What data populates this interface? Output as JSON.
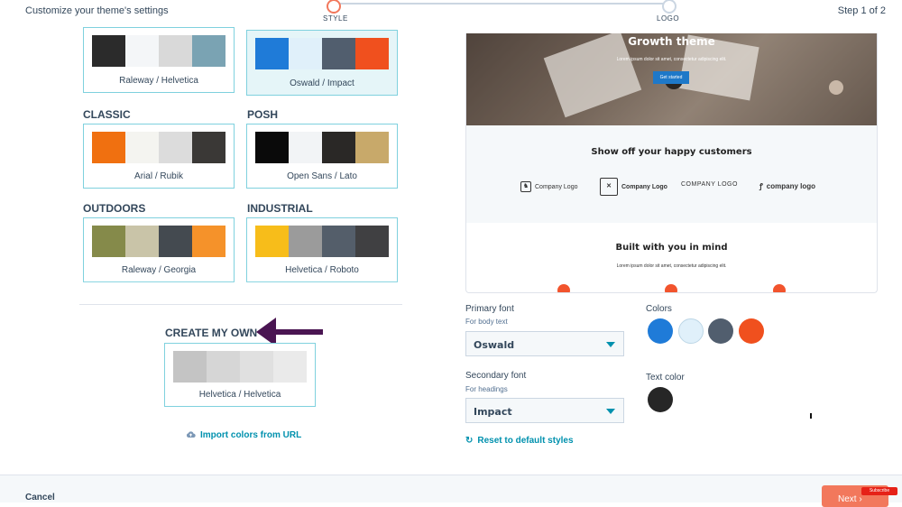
{
  "header": {
    "title": "Customize your theme's settings",
    "step_counter": "Step 1 of 2",
    "steps": [
      {
        "label": "STYLE"
      },
      {
        "label": "LOGO"
      }
    ]
  },
  "themes": [
    {
      "name": "",
      "font_pair": "Raleway / Helvetica",
      "colors": [
        "#2b2b2b",
        "#f4f6f8",
        "#d9d9d9",
        "#7aa3b3"
      ],
      "selected": false
    },
    {
      "name": "",
      "font_pair": "Oswald / Impact",
      "colors": [
        "#1f7bd8",
        "#e0f0fa",
        "#515e6e",
        "#f0501e"
      ],
      "selected": true
    },
    {
      "name": "CLASSIC",
      "font_pair": "Arial / Rubik",
      "colors": [
        "#f07010",
        "#f4f4f0",
        "#dcdcdc",
        "#3a3836"
      ],
      "selected": false
    },
    {
      "name": "POSH",
      "font_pair": "Open Sans / Lato",
      "colors": [
        "#0a0a0a",
        "#f2f4f6",
        "#2a2826",
        "#c8a96a"
      ],
      "selected": false
    },
    {
      "name": "OUTDOORS",
      "font_pair": "Raleway / Georgia",
      "colors": [
        "#858a4a",
        "#c9c4a8",
        "#444a50",
        "#f5922a"
      ],
      "selected": false
    },
    {
      "name": "INDUSTRIAL",
      "font_pair": "Helvetica / Roboto",
      "colors": [
        "#f7bd1a",
        "#9b9b9b",
        "#545e6a",
        "#404042"
      ],
      "selected": false
    }
  ],
  "create_own": {
    "title": "CREATE MY OWN",
    "font_pair": "Helvetica / Helvetica",
    "colors": [
      "#c4c4c4",
      "#d6d6d6",
      "#e0e0e0",
      "#eaeaea"
    ],
    "import_link": "Import colors from URL"
  },
  "preview": {
    "hero_title": "Growth theme",
    "hero_sub": "Lorem ipsum dolor sit amet, consectetur adipiscing elit.",
    "hero_button": "Get started",
    "customers_title": "Show off your happy customers",
    "logos": [
      "Company Logo",
      "Company Logo",
      "COMPANY LOGO",
      "company logo"
    ],
    "built_title": "Built with you in mind",
    "built_sub": "Lorem ipsum dolor sit amet, consectetur adipiscing elit."
  },
  "settings": {
    "primary_font_label": "Primary font",
    "primary_font_sub": "For body text",
    "primary_font_value": "Oswald",
    "secondary_font_label": "Secondary font",
    "secondary_font_sub": "For headings",
    "secondary_font_value": "Impact",
    "reset_link": "Reset to default styles",
    "colors_label": "Colors",
    "colors": [
      "#1f7bd8",
      "#e0f0fa",
      "#515e6e",
      "#f0501e"
    ],
    "text_color_label": "Text color",
    "text_color": "#262626"
  },
  "footer": {
    "cancel": "Cancel",
    "next": "Next",
    "subscribe_badge": "Subscribe"
  }
}
